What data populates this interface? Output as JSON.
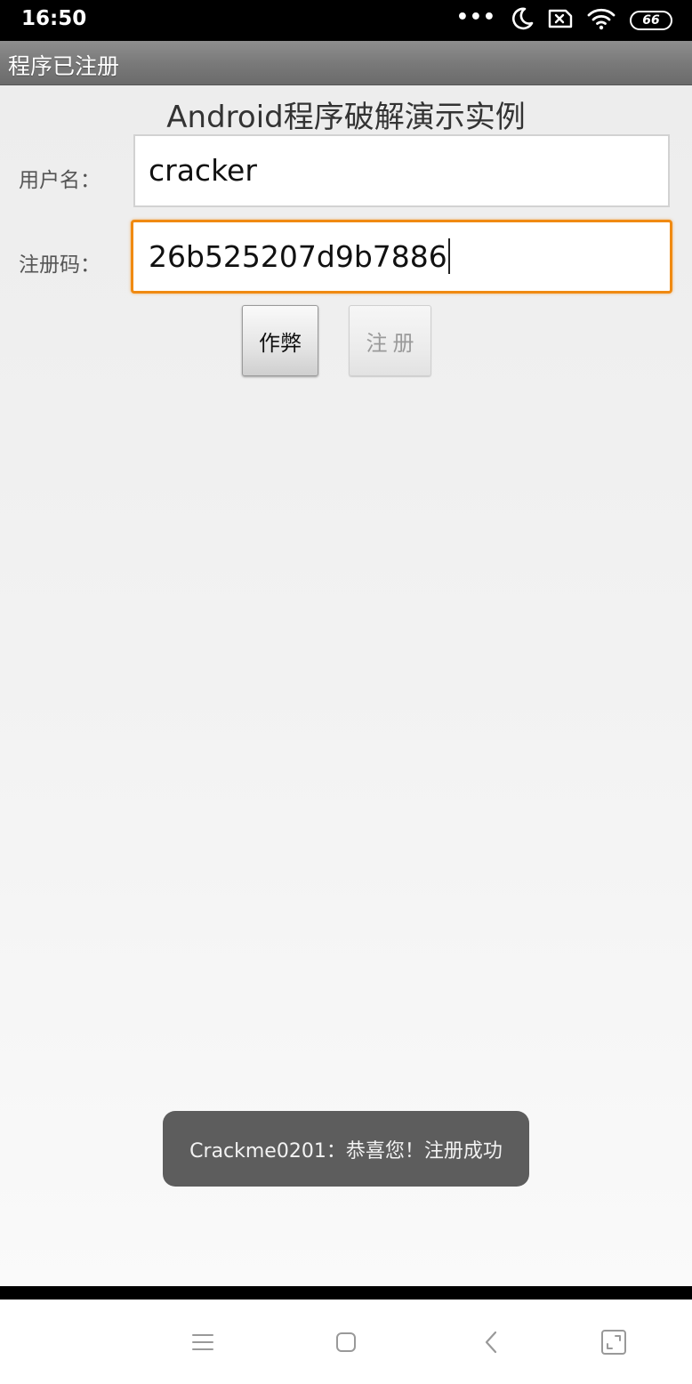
{
  "status_bar": {
    "time": "16:50",
    "dots": "•••",
    "battery_level": "66",
    "icons": [
      "more-dots-icon",
      "moon-icon",
      "sim-off-icon",
      "wifi-icon",
      "battery-icon"
    ]
  },
  "title_bar": {
    "title": "程序已注册"
  },
  "main": {
    "heading": "Android程序破解演示实例",
    "username_label": "用户名：",
    "username_value": "cracker",
    "code_label": "注册码：",
    "code_value": "26b525207d9b7886",
    "cheat_button_label": "作弊",
    "register_button_label": "注册"
  },
  "toast": {
    "message": "Crackme0201：恭喜您！注册成功"
  },
  "nav_bar": {
    "icons": [
      "menu-icon",
      "home-icon",
      "back-icon",
      "expand-icon"
    ]
  },
  "colors": {
    "focus_border": "#f08a12",
    "title_bar": "#7a7a7a",
    "toast_bg": "#5d5d5d"
  }
}
